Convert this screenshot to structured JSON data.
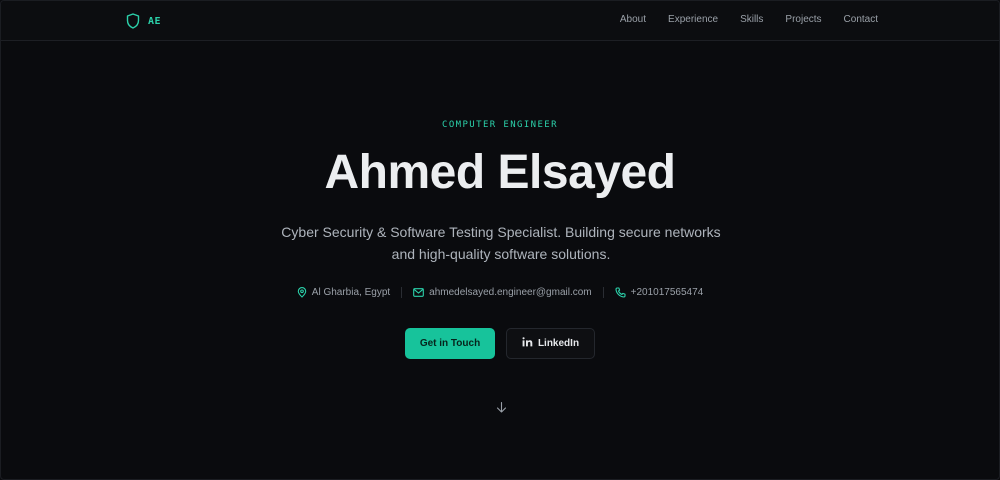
{
  "nav": {
    "brand": "AE",
    "brand_icon": "shield-icon",
    "links": [
      "About",
      "Experience",
      "Skills",
      "Projects",
      "Contact"
    ]
  },
  "hero": {
    "eyebrow": "COMPUTER ENGINEER",
    "name": "Ahmed Elsayed",
    "subtitle": "Cyber Security & Software Testing Specialist. Building secure networks and high-quality software solutions.",
    "contacts": {
      "location": "Al Gharbia, Egypt",
      "email": "ahmedelsayed.engineer@gmail.com",
      "phone": "+201017565474"
    },
    "cta_primary": "Get in Touch",
    "cta_secondary": "LinkedIn",
    "scroll_icon": "arrow-down-icon"
  },
  "colors": {
    "accent": "#17c39b",
    "accent_text": "#2bd1aa",
    "background": "#0a0b0e"
  }
}
